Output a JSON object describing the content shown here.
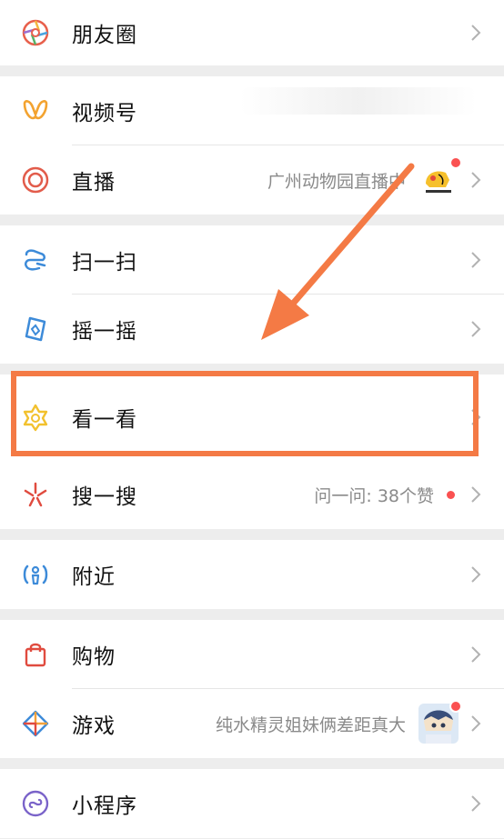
{
  "colors": {
    "accent_orange": "#f47a45",
    "badge_red": "#fa5151",
    "hint_gray": "#8a8a8a"
  },
  "menu": {
    "moments": {
      "label": "朋友圈",
      "icon": "moments-aperture-icon"
    },
    "channels": {
      "label": "视频号",
      "icon": "channels-butterfly-icon"
    },
    "live": {
      "label": "直播",
      "icon": "live-ring-icon",
      "hint": "广州动物园直播中"
    },
    "scan": {
      "label": "扫一扫",
      "icon": "scan-icon"
    },
    "shake": {
      "label": "摇一摇",
      "icon": "shake-icon"
    },
    "topstories": {
      "label": "看一看",
      "icon": "top-stories-star-icon"
    },
    "search": {
      "label": "搜一搜",
      "icon": "search-spark-icon",
      "hint": "问一问: 38个赞"
    },
    "nearby": {
      "label": "附近",
      "icon": "nearby-person-icon"
    },
    "shopping": {
      "label": "购物",
      "icon": "shopping-bag-icon"
    },
    "games": {
      "label": "游戏",
      "icon": "games-diamond-icon",
      "hint": "纯水精灵姐妹俩差距真大"
    },
    "miniprograms": {
      "label": "小程序",
      "icon": "mini-program-icon"
    }
  },
  "annotation": {
    "highlight_target": "看一看",
    "arrow": "pointing-down-left-arrow"
  }
}
